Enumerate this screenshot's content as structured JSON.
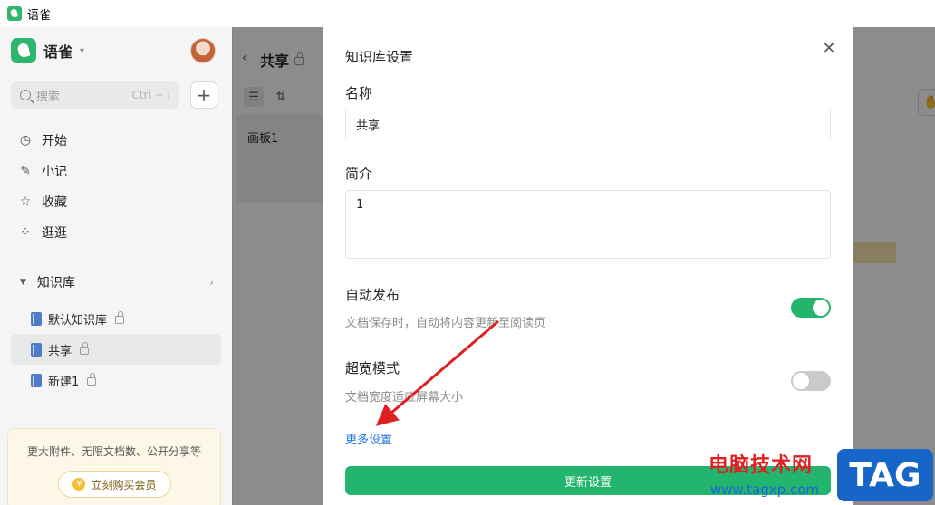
{
  "window": {
    "title": "语雀"
  },
  "sidebar": {
    "app_name": "语雀",
    "search": {
      "placeholder": "搜索",
      "shortcut": "Ctrl + J"
    },
    "nav": [
      {
        "label": "开始",
        "icon": "clock-icon"
      },
      {
        "label": "小记",
        "icon": "feather-icon"
      },
      {
        "label": "收藏",
        "icon": "star-icon"
      },
      {
        "label": "逛逛",
        "icon": "grid-icon"
      }
    ],
    "kb_header": "知识库",
    "kb_items": [
      {
        "label": "默认知识库",
        "active": false
      },
      {
        "label": "共享",
        "active": true
      },
      {
        "label": "新建1",
        "active": false
      }
    ],
    "promo": {
      "text": "更大附件、无限文档数、公开分享等",
      "button": "立刻购买会员"
    }
  },
  "mid": {
    "back": "‹",
    "title": "共享",
    "doc": "画板1"
  },
  "dialog": {
    "title": "知识库设置",
    "close": "×",
    "name_label": "名称",
    "name_value": "共享",
    "intro_label": "简介",
    "intro_value": "1",
    "autopub": {
      "label": "自动发布",
      "desc": "文档保存时，自动将内容更新至阅读页",
      "on": true
    },
    "wide": {
      "label": "超宽模式",
      "desc": "文档宽度适应屏幕大小",
      "on": false
    },
    "more_link": "更多设置",
    "update_button": "更新设置"
  },
  "colors": {
    "accent": "#23b46e",
    "link": "#1f74e3",
    "annotation_arrow": "#e02020"
  },
  "watermark": {
    "text": "电脑技术网",
    "url": "www.tagxp.com",
    "tag": "TAG"
  }
}
